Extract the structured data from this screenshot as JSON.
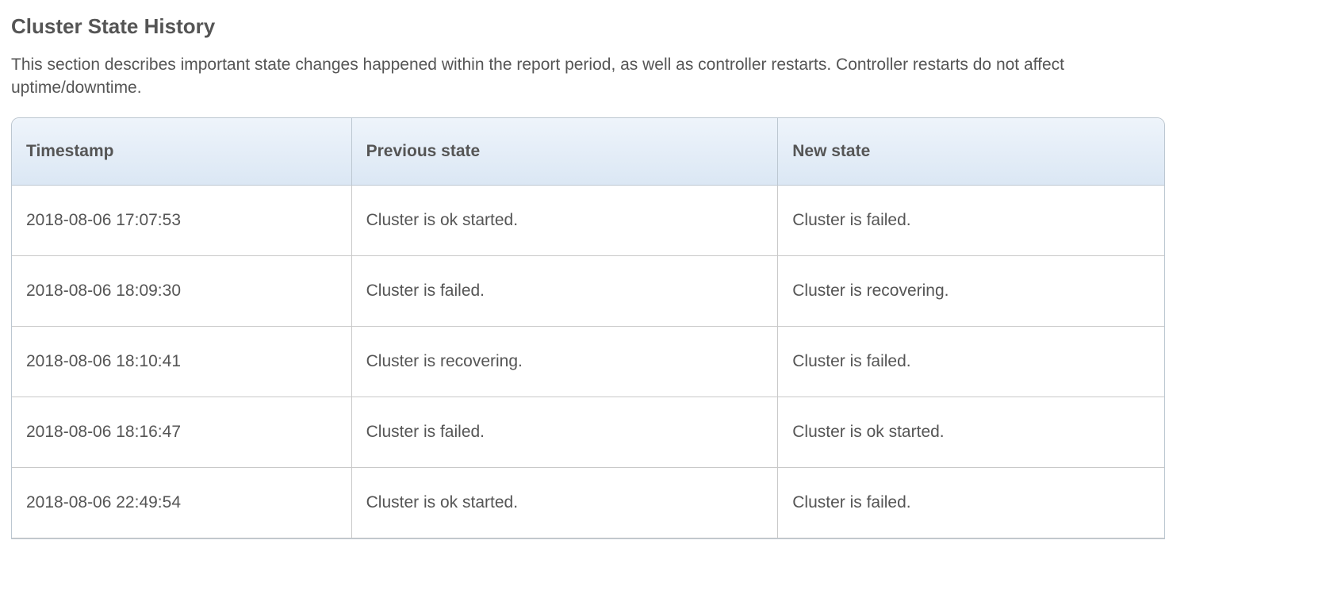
{
  "header": {
    "title": "Cluster State History",
    "description": "This section describes important state changes happened within the report period, as well as controller restarts. Controller restarts do not affect uptime/downtime."
  },
  "table": {
    "columns": [
      "Timestamp",
      "Previous state",
      "New state"
    ],
    "rows": [
      {
        "timestamp": "2018-08-06 17:07:53",
        "previous": "Cluster is ok started.",
        "next": "Cluster is failed."
      },
      {
        "timestamp": "2018-08-06 18:09:30",
        "previous": "Cluster is failed.",
        "next": "Cluster is recovering."
      },
      {
        "timestamp": "2018-08-06 18:10:41",
        "previous": "Cluster is recovering.",
        "next": "Cluster is failed."
      },
      {
        "timestamp": "2018-08-06 18:16:47",
        "previous": "Cluster is failed.",
        "next": "Cluster is ok started."
      },
      {
        "timestamp": "2018-08-06 22:49:54",
        "previous": "Cluster is ok started.",
        "next": "Cluster is failed."
      }
    ]
  }
}
